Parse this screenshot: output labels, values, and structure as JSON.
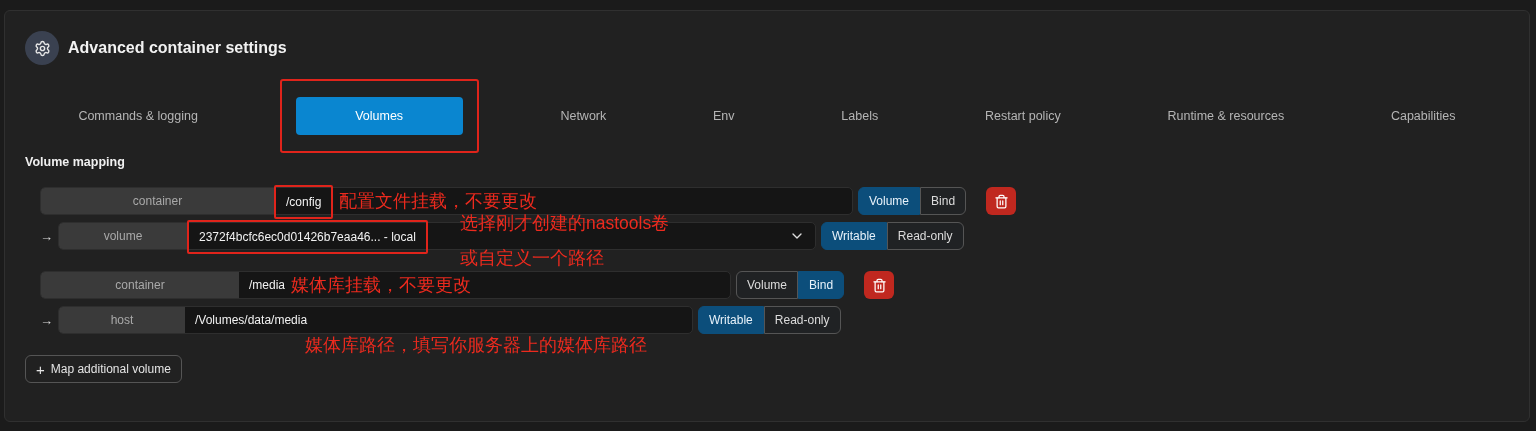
{
  "header": {
    "title": "Advanced container settings"
  },
  "tabs": [
    {
      "label": "Commands & logging",
      "selected": false,
      "highlighted": false
    },
    {
      "label": "Volumes",
      "selected": true,
      "highlighted": true
    },
    {
      "label": "Network",
      "selected": false,
      "highlighted": false
    },
    {
      "label": "Env",
      "selected": false,
      "highlighted": false
    },
    {
      "label": "Labels",
      "selected": false,
      "highlighted": false
    },
    {
      "label": "Restart policy",
      "selected": false,
      "highlighted": false
    },
    {
      "label": "Runtime & resources",
      "selected": false,
      "highlighted": false
    },
    {
      "label": "Capabilities",
      "selected": false,
      "highlighted": false
    }
  ],
  "section_title": "Volume mapping",
  "volumes": [
    {
      "container": {
        "label": "container",
        "value": "/config",
        "highlighted": true,
        "note": "配置文件挂载，不要更改"
      },
      "type_toggle": [
        {
          "label": "Volume",
          "selected": true
        },
        {
          "label": "Bind",
          "selected": false
        }
      ],
      "source": {
        "kind": "select",
        "arrow": "→",
        "label": "volume",
        "value": "2372f4bcfc6ec0d01426b7eaa46... - local",
        "highlighted": true,
        "notes": [
          "选择刚才创建的nastools卷",
          "或自定义一个路径"
        ]
      },
      "access_toggle": [
        {
          "label": "Writable",
          "selected": true
        },
        {
          "label": "Read-only",
          "selected": false
        }
      ]
    },
    {
      "container": {
        "label": "container",
        "value": "/media",
        "highlighted": false,
        "note": "媒体库挂载，不要更改"
      },
      "type_toggle": [
        {
          "label": "Volume",
          "selected": false
        },
        {
          "label": "Bind",
          "selected": true
        }
      ],
      "source": {
        "kind": "input",
        "arrow": "→",
        "label": "host",
        "value": "/Volumes/data/media",
        "highlighted": false,
        "notes": [
          "媒体库路径，填写你服务器上的媒体库路径"
        ]
      },
      "access_toggle": [
        {
          "label": "Writable",
          "selected": true
        },
        {
          "label": "Read-only",
          "selected": false
        }
      ]
    }
  ],
  "add_button": {
    "icon": "+",
    "label": "Map additional volume"
  }
}
